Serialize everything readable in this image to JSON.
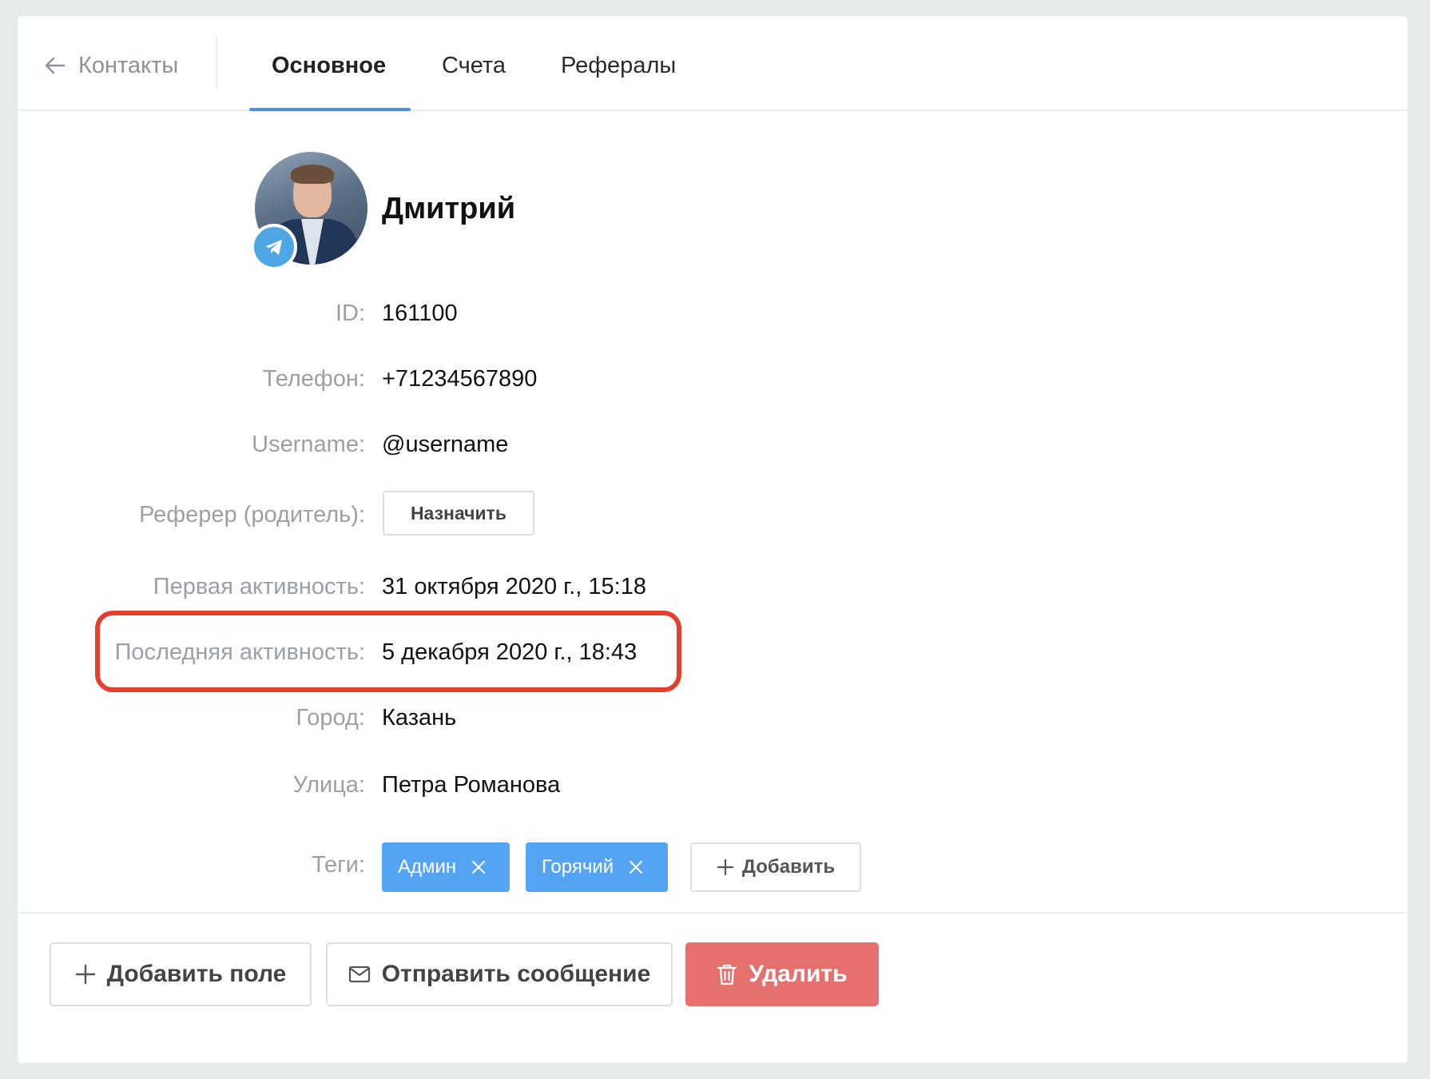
{
  "header": {
    "back_label": "Контакты",
    "tabs": [
      {
        "label": "Основное",
        "active": true
      },
      {
        "label": "Счета",
        "active": false
      },
      {
        "label": "Рефералы",
        "active": false
      }
    ]
  },
  "profile": {
    "name": "Дмитрий",
    "messenger_icon": "telegram-icon"
  },
  "fields": {
    "id": {
      "label": "ID:",
      "value": "161100"
    },
    "phone": {
      "label": "Телефон:",
      "value": "+71234567890"
    },
    "username": {
      "label": "Username:",
      "value": "@username"
    },
    "referrer": {
      "label": "Реферер (родитель):",
      "button_label": "Назначить"
    },
    "first_activity": {
      "label": "Первая активность:",
      "value": "31 октября 2020 г., 15:18"
    },
    "last_activity": {
      "label": "Последняя активность:",
      "value": "5 декабря 2020 г., 18:43"
    },
    "city": {
      "label": "Город:",
      "value": "Казань"
    },
    "street": {
      "label": "Улица:",
      "value": "Петра Романова"
    },
    "tags": {
      "label": "Теги:",
      "items": [
        {
          "label": "Админ"
        },
        {
          "label": "Горячий"
        }
      ],
      "add_label": "Добавить"
    }
  },
  "footer": {
    "add_field_label": "Добавить поле",
    "send_message_label": "Отправить сообщение",
    "delete_label": "Удалить"
  },
  "colors": {
    "accent": "#4a90e2",
    "tag": "#55a3f3",
    "danger": "#e5716f",
    "highlight": "#e23f2f"
  }
}
